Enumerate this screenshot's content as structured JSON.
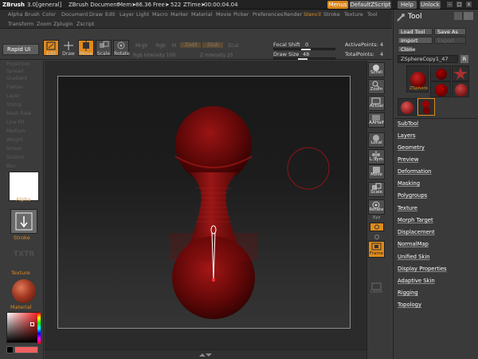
{
  "titlebar": {
    "app": "ZBrush",
    "version": "3.0[general]",
    "document": "ZBrush Document",
    "mem_label": "Mem➤",
    "mem": "86.36",
    "free_label": "Free➤",
    "free": "522",
    "ztime_label": "ZTime➤",
    "ztime": "00:00:04.04",
    "buttons": {
      "menus": "Menus",
      "script": "DefaultZScript",
      "help": "Help",
      "unlock": "Unlock"
    },
    "window_controls": {
      "min": "-",
      "max": "□",
      "close": "x"
    }
  },
  "menus": {
    "row1": [
      "Alpha",
      "Brush",
      "Color",
      "Document",
      "Draw",
      "Edit",
      "Layer",
      "Light",
      "Macro",
      "Marker",
      "Material",
      "Movie",
      "Picker",
      "Preferences",
      "Render",
      "Stencil",
      "Stroke",
      "Texture",
      "Tool"
    ],
    "row2": [
      "Transform",
      "Zoom",
      "Zplugin",
      "Zscript"
    ]
  },
  "shelf": {
    "rapid_ui": "Rapid UI",
    "buttons": [
      {
        "label": "Edit",
        "icon": "edit-icon",
        "active": true
      },
      {
        "label": "Draw",
        "icon": "draw-icon",
        "active": false
      },
      {
        "label": "Move",
        "icon": "move-icon",
        "active": true
      },
      {
        "label": "Scale",
        "icon": "scale-icon",
        "active": false
      },
      {
        "label": "Rotate",
        "icon": "rotate-icon",
        "active": false
      }
    ],
    "dim": {
      "mrgb": "Mrgb",
      "rgb": "Rgb",
      "m": "M",
      "zadd": "Zadd",
      "zsub": "Zsub",
      "zcut": "Zcut",
      "rgb_intensity": "Rgb Intensity 100",
      "z_intensity": "Z Intensity 25"
    },
    "focal_shift_label": "Focal Shift",
    "focal_shift": "0",
    "draw_size_label": "Draw Size",
    "draw_size": "48",
    "active_points_label": "ActivePoints:",
    "active_points": "4",
    "total_points_label": "TotalPoints:",
    "total_points": "4"
  },
  "leftpanel": {
    "dim_items": [
      "Projection",
      "Spread",
      "Gradient",
      "Flatten",
      "Layer",
      "Stamp",
      "Mesh Rate",
      "Line Fill",
      "Medium",
      "Weight",
      "Smear",
      "Scratch",
      "Blur"
    ],
    "alpha_label": "Alpha",
    "stroke_label": "Stroke",
    "texture_label": "Texture",
    "texture_tile": "TXTR",
    "material_label": "Material"
  },
  "rtool": {
    "items": [
      {
        "label": "Scroll",
        "icon": "scroll-icon",
        "active": false
      },
      {
        "label": "Zoom",
        "icon": "zoom-icon",
        "active": false
      },
      {
        "label": "Actual",
        "icon": "actual-icon",
        "active": false
      },
      {
        "label": "AAHalf",
        "icon": "aahalf-icon",
        "active": false
      },
      {
        "label": "Local",
        "icon": "local-icon",
        "active": false
      },
      {
        "label": "L.Sym",
        "icon": "lsym-icon",
        "active": false
      },
      {
        "label": "Move",
        "icon": "move-icon",
        "active": false
      },
      {
        "label": "Scale",
        "icon": "scale-icon",
        "active": false
      },
      {
        "label": "Rotate",
        "icon": "rotate-icon",
        "active": false
      }
    ],
    "xyz_label": "Xyz",
    "frame_label": "Frame",
    "lasso_label": "Lasso"
  },
  "rpanel": {
    "title": "Tool",
    "load_tool": "Load Tool",
    "save_as": "Save As",
    "import": "Import",
    "export": "Export",
    "clone": "Clone",
    "current_tool": "ZSphereCopy1_47",
    "r_button": "R",
    "thumb_label": "ZSphere",
    "sections": [
      "SubTool",
      "Layers",
      "Geometry",
      "Preview",
      "Deformation",
      "Masking",
      "Polygroups",
      "Texture",
      "Morph Target",
      "Displacement",
      "NormalMap",
      "Unified Skin",
      "Display Properties",
      "Adaptive Skin",
      "Rigging",
      "Topology"
    ]
  },
  "colors": {
    "accent": "#e08a1c",
    "panel": "#3a3a3a",
    "model_red": "#7a0a0a"
  }
}
